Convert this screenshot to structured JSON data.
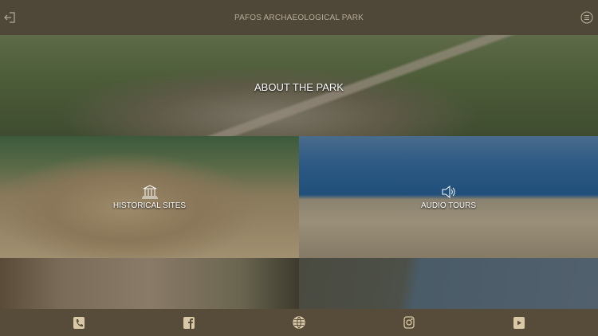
{
  "header": {
    "title": "PAFOS ARCHAEOLOGICAL PARK",
    "left_icon": "exit-icon",
    "right_icon": "menu-icon"
  },
  "tiles": [
    {
      "label": "ABOUT THE PARK"
    },
    {
      "label": "HISTORICAL SITES",
      "icon": "columns-icon"
    },
    {
      "label": "AUDIO TOURS",
      "icon": "speaker-icon"
    },
    {
      "label": ""
    },
    {
      "label": ""
    }
  ],
  "footer": {
    "icons": [
      "phone-icon",
      "facebook-icon",
      "globe-icon",
      "instagram-icon",
      "youtube-icon"
    ]
  },
  "colors": {
    "bar": "#4f4838",
    "icon": "#d9c9a6"
  }
}
